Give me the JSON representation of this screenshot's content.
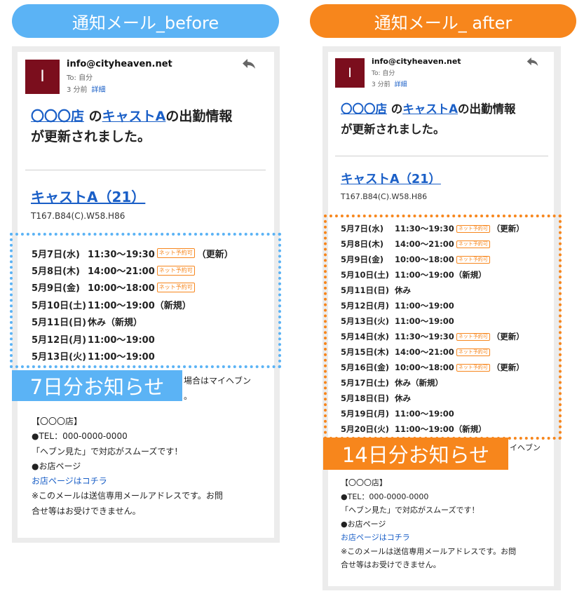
{
  "before": {
    "title": "通知メール_before",
    "avatar_letter": "I",
    "from": "info@cityheaven.net",
    "to": "To: 自分",
    "time": "3 分前",
    "detail": "詳細",
    "shop_link": "〇〇〇店",
    "mid1": " の",
    "cast_link": "キャストA",
    "mid2": "の出勤情報",
    "line2": "が更新されました。",
    "cast_title": "キャストA（21）",
    "measurements": "T167.B84(C).W58.H86",
    "schedule": [
      {
        "day": "5月7日(水)",
        "time": "11:30～19:30",
        "tag": "ネット予約可",
        "note": "（更新）"
      },
      {
        "day": "5月8日(木)",
        "time": "14:00～21:00",
        "tag": "ネット予約可",
        "note": ""
      },
      {
        "day": "5月9日(金)",
        "time": "10:00～18:00",
        "tag": "ネット予約可",
        "note": ""
      },
      {
        "day": "5月10日(土)",
        "time": "11:00～19:00（新規）",
        "tag": "",
        "note": ""
      },
      {
        "day": "5月11日(日)",
        "time": "休み（新規）",
        "tag": "",
        "note": ""
      },
      {
        "day": "5月12日(月)",
        "time": "11:00～19:00",
        "tag": "",
        "note": ""
      },
      {
        "day": "5月13日(火)",
        "time": "11:00～19:00",
        "tag": "",
        "note": ""
      }
    ],
    "overlay_label": "7日分お知らせ",
    "peek_line1": "場合はマイヘブン",
    "peek_line2": "。",
    "footer": {
      "shop_bracket": "【〇〇〇店】",
      "tel": "●TEL：000-0000-0000",
      "heaven": "「ヘブン見た」で対応がスムーズです！",
      "page_label": "●お店ページ",
      "page_link": "お店ページはコチラ",
      "notice1": "※このメールは送信専用メールアドレスです。お問",
      "notice2": "合せ等はお受けできません。"
    }
  },
  "after": {
    "title": "通知メール_ after",
    "avatar_letter": "I",
    "from": "info@cityheaven.net",
    "to": "To: 自分",
    "time": "3 分前",
    "detail": "詳細",
    "shop_link": "〇〇〇店",
    "mid1": " の",
    "cast_link": "キャストA",
    "mid2": "の出勤情報",
    "line2": "が更新されました。",
    "cast_title": "キャストA（21）",
    "measurements": "T167.B84(C).W58.H86",
    "schedule": [
      {
        "day": "5月7日(水)",
        "time": "11:30～19:30",
        "tag": "ネット予約可",
        "note": "（更新）"
      },
      {
        "day": "5月8日(木)",
        "time": "14:00～21:00",
        "tag": "ネット予約可",
        "note": ""
      },
      {
        "day": "5月9日(金)",
        "time": "10:00～18:00",
        "tag": "ネット予約可",
        "note": ""
      },
      {
        "day": "5月10日(土)",
        "time": "11:00～19:00（新規）",
        "tag": "",
        "note": ""
      },
      {
        "day": "5月11日(日)",
        "time": "休み",
        "tag": "",
        "note": ""
      },
      {
        "day": "5月12日(月)",
        "time": "11:00～19:00",
        "tag": "",
        "note": ""
      },
      {
        "day": "5月13日(火)",
        "time": "11:00～19:00",
        "tag": "",
        "note": ""
      },
      {
        "day": "5月14日(水)",
        "time": "11:30～19:30",
        "tag": "ネット予約可",
        "note": "（更新）"
      },
      {
        "day": "5月15日(木)",
        "time": "14:00～21:00",
        "tag": "ネット予約可",
        "note": ""
      },
      {
        "day": "5月16日(金)",
        "time": "10:00～18:00",
        "tag": "ネット予約可",
        "note": "（更新）"
      },
      {
        "day": "5月17日(土)",
        "time": "休み（新規）",
        "tag": "",
        "note": ""
      },
      {
        "day": "5月18日(日)",
        "time": "休み",
        "tag": "",
        "note": ""
      },
      {
        "day": "5月19日(月)",
        "time": "11:00～19:00",
        "tag": "",
        "note": ""
      },
      {
        "day": "5月20日(火)",
        "time": "11:00～19:00（新規）",
        "tag": "",
        "note": ""
      }
    ],
    "overlay_label": "14日分お知らせ",
    "peek_line1": "イヘブン",
    "footer": {
      "shop_bracket": "【〇〇〇店】",
      "tel": "●TEL：000-0000-0000",
      "heaven": "「ヘブン見た」で対応がスムーズです！",
      "page_label": "●お店ページ",
      "page_link": "お店ページはコチラ",
      "notice1": "※このメールは送信専用メールアドレスです。お問",
      "notice2": "合せ等はお受けできません。"
    }
  }
}
